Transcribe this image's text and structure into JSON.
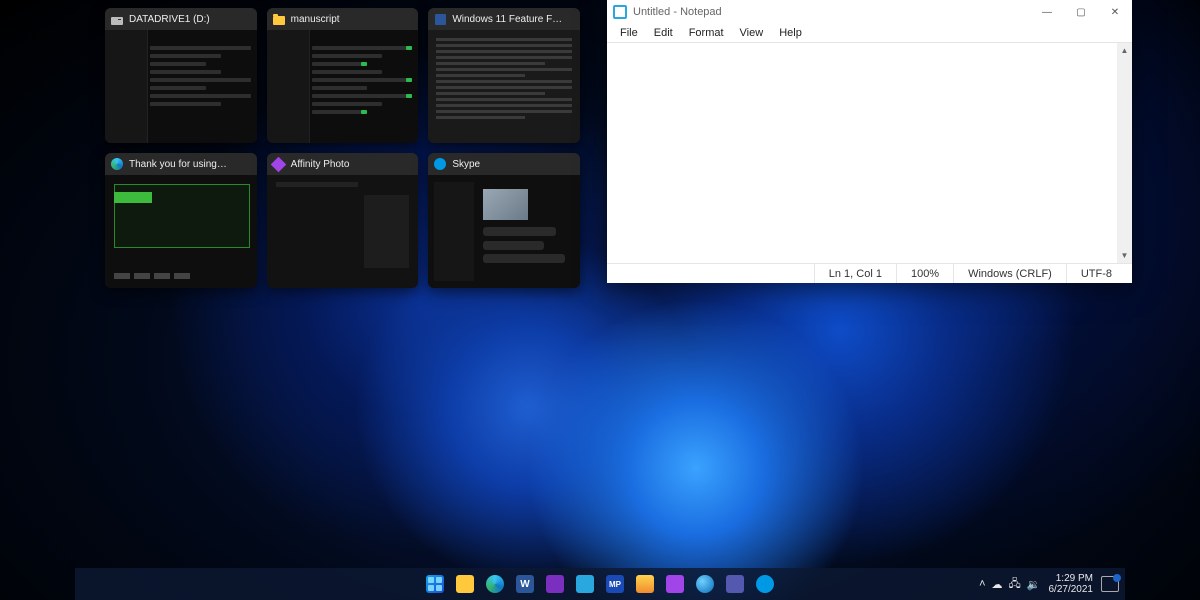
{
  "snap_assist": {
    "thumbs": [
      {
        "title": "DATADRIVE1 (D:)",
        "icon": "drive-icon"
      },
      {
        "title": "manuscript",
        "icon": "folder-icon"
      },
      {
        "title": "Windows 11 Feature F…",
        "icon": "word-icon"
      },
      {
        "title": "Thank you for using…",
        "icon": "edge-icon"
      },
      {
        "title": "Affinity Photo",
        "icon": "affinity-icon"
      },
      {
        "title": "Skype",
        "icon": "skype-icon"
      }
    ]
  },
  "notepad": {
    "title": "Untitled - Notepad",
    "menu": [
      "File",
      "Edit",
      "Format",
      "View",
      "Help"
    ],
    "status": {
      "position": "Ln 1, Col 1",
      "zoom": "100%",
      "line_ending": "Windows (CRLF)",
      "encoding": "UTF-8"
    },
    "window_controls": {
      "min": "—",
      "max": "▢",
      "close": "✕"
    }
  },
  "taskbar": {
    "apps": [
      "start",
      "file-explorer",
      "edge",
      "word",
      "onenote",
      "notepad",
      "macro-program",
      "misc-app",
      "affinity-photo",
      "browser-globe",
      "teams",
      "skype"
    ],
    "tray_icons": [
      "chevron-up",
      "cloud",
      "network",
      "volume"
    ],
    "clock": {
      "time": "1:29 PM",
      "date": "6/27/2021"
    },
    "notification_count": "1"
  }
}
